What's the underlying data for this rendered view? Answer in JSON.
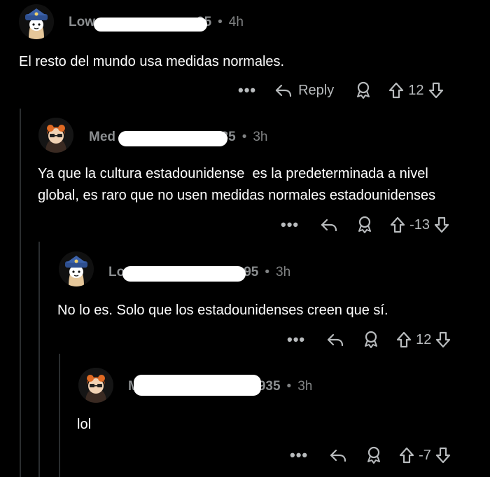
{
  "comments": [
    {
      "username_visible_start": "Low",
      "username_visible_end": "95",
      "separator": "•",
      "time": "4h",
      "text": "El resto del mundo usa medidas normales.",
      "more": "•••",
      "reply_label": "Reply",
      "score": "12",
      "avatar_icon": "captain-hat-avatar-icon"
    },
    {
      "username_visible_start": "Med",
      "username_visible_end": "935",
      "separator": "•",
      "time": "3h",
      "text": "Ya que la cultura estadounidense  es la predeterminada a nivel\nglobal, es raro que no usen medidas normales estadounidenses",
      "more": "•••",
      "reply_label": "",
      "score": "-13",
      "avatar_icon": "redhead-avatar-icon"
    },
    {
      "username_visible_start": "Lo",
      "username_visible_end": "95",
      "separator": "•",
      "time": "3h",
      "text": "No lo es. Solo que los estadounidenses creen que sí.",
      "more": "•••",
      "reply_label": "",
      "score": "12",
      "avatar_icon": "captain-hat-avatar-icon"
    },
    {
      "username_visible_start": "M",
      "username_visible_end": "935",
      "separator": "•",
      "time": "3h",
      "text": "lol",
      "more": "•••",
      "reply_label": "",
      "score": "-7",
      "avatar_icon": "redhead-avatar-icon"
    }
  ],
  "colors": {
    "background": "#000000",
    "text": "#ffffff",
    "meta": "#818384",
    "thread_line": "#2a2d2f"
  }
}
